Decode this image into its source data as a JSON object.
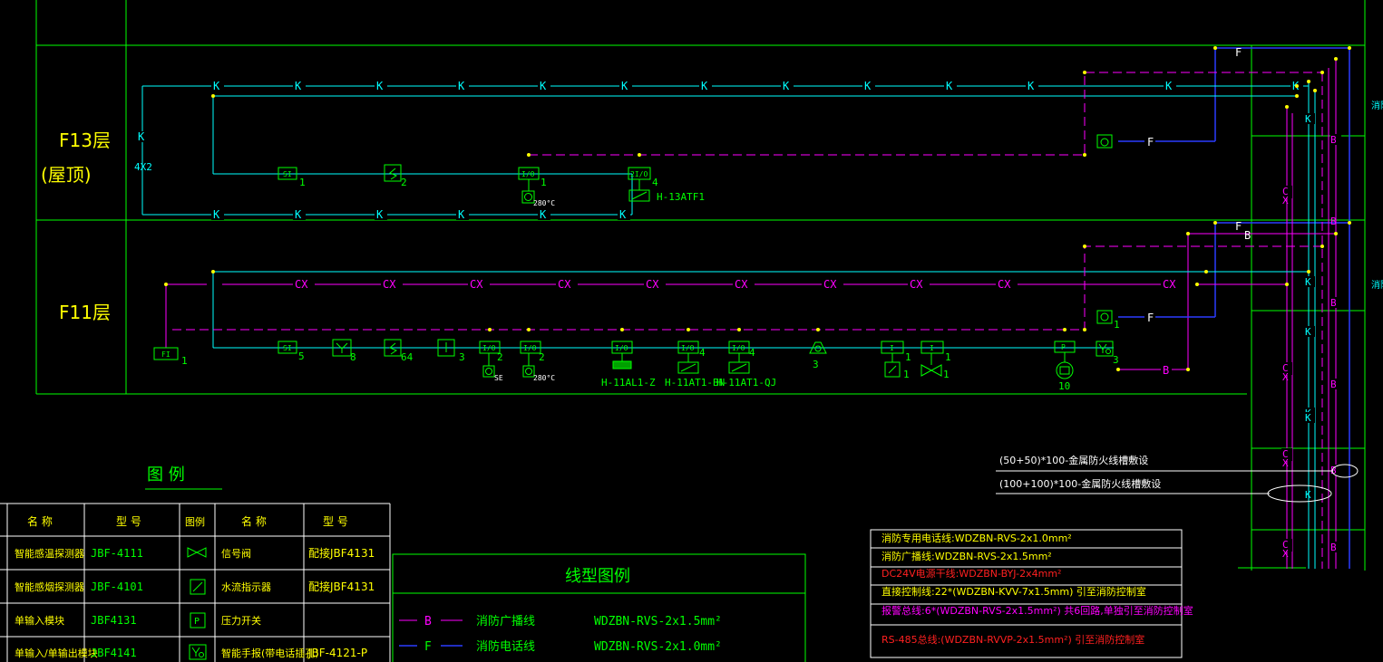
{
  "colors": {
    "frame": "#00ff00",
    "cyan": "#00ffff",
    "magenta": "#ff00ff",
    "blue": "#2a3cff",
    "yellow": "#ffff00",
    "red": "#ff2020",
    "white": "#ffffff",
    "green": "#00ff00"
  },
  "floors": {
    "f13": {
      "label": "F13层",
      "sub": "(屋顶)"
    },
    "f11": {
      "label": "F11层"
    }
  },
  "wire": {
    "k": "K",
    "f": "F",
    "b": "B",
    "cx": "CX",
    "qty": "4X2"
  },
  "devices": {
    "f13": {
      "si": {
        "code": "SI",
        "count": "1"
      },
      "smoke": {
        "count": "2"
      },
      "io1": {
        "code": "I/O",
        "count": "1"
      },
      "io2": {
        "code": "2I/O",
        "count": "4"
      },
      "fd280": {
        "label": "280°C"
      },
      "atf": {
        "label": "H-13ATF1"
      }
    },
    "f11": {
      "fi": {
        "code": "FI",
        "count": "1"
      },
      "si": {
        "code": "SI",
        "count": "5"
      },
      "y": {
        "count": "8"
      },
      "smoke": {
        "count": "64"
      },
      "man": {
        "count": "3"
      },
      "io_se": {
        "code": "I/O",
        "count": "2",
        "label": "SE"
      },
      "io_280": {
        "code": "I/O",
        "count": "2",
        "label": "280°C"
      },
      "io_z": {
        "code": "I/O",
        "label": "H-11AL1-Z"
      },
      "io_bn": {
        "code": "I/O",
        "count": "4",
        "label": "H-11AT1-BN"
      },
      "io_qj": {
        "code": "I/O",
        "count": "4",
        "label": "H-11AT1-QJ"
      },
      "horn": {
        "count": "3"
      },
      "flow": {
        "code": "I",
        "count": "1"
      },
      "valve": {
        "code": "I",
        "count": "1"
      },
      "speaker": {
        "code": "P",
        "count": "10"
      },
      "phone": {
        "count": "1"
      },
      "hydrant": {
        "count": "3"
      }
    }
  },
  "tray": {
    "t1": "(50+50)*100-金属防火线槽敷设",
    "t2": "(100+100)*100-金属防火线槽敷设"
  },
  "side_text": {
    "a": "消防",
    "b": "消防"
  },
  "legend": {
    "title": "图  例",
    "headers": [
      "名  称",
      "型  号",
      "图例",
      "名  称",
      "型  号"
    ],
    "rows": [
      {
        "name": "智能感温探测器",
        "model": "JBF-4111",
        "name2": "信号阀",
        "model2": "配接JBF4131"
      },
      {
        "name": "智能感烟探测器",
        "model": "JBF-4101",
        "name2": "水流指示器",
        "model2": "配接JBF4131"
      },
      {
        "name": "单输入模块",
        "model": "JBF4131",
        "name2": "压力开关",
        "model2": ""
      },
      {
        "name": "单输入/单输出模块",
        "model": "JBF4141",
        "name2": "智能手报(带电话插孔)",
        "model2": "JBF-4121-P"
      }
    ]
  },
  "line_legend": {
    "title": "线型图例",
    "rows": [
      {
        "sym": "B",
        "name": "消防广播线",
        "spec": "WDZBN-RVS-2x1.5mm²"
      },
      {
        "sym": "F",
        "name": "消防电话线",
        "spec": "WDZBN-RVS-2x1.0mm²"
      }
    ]
  },
  "wiring_notes": [
    {
      "text": "消防专用电话线:WDZBN-RVS-2x1.0mm²",
      "color": "#ffff00"
    },
    {
      "text": "消防广播线:WDZBN-RVS-2x1.5mm²",
      "color": "#ffff00"
    },
    {
      "text": "DC24V电源干线:WDZBN-BYJ-2x4mm²",
      "color": "#ff2020"
    },
    {
      "text": "直接控制线:22*(WDZBN-KVV-7x1.5mm)  引至消防控制室",
      "color": "#ffff00"
    },
    {
      "text": "报警总线:6*(WDZBN-RVS-2x1.5mm²)  共6回路,单独引至消防控制室",
      "color": "#ff00ff"
    },
    {
      "text": "RS-485总线:(WDZBN-RVVP-2x1.5mm²)  引至消防控制室",
      "color": "#ff2020"
    }
  ]
}
